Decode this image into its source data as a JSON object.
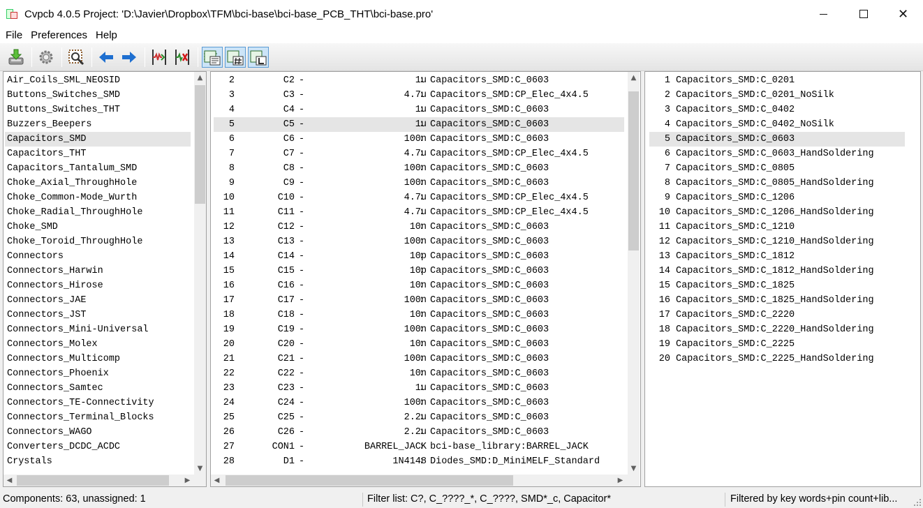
{
  "window": {
    "title": "Cvpcb 4.0.5  Project: 'D:\\Javier\\Dropbox\\TFM\\bci-base\\bci-base_PCB_THT\\bci-base.pro'",
    "minimize": "",
    "maximize": "",
    "close": "✕"
  },
  "menu": [
    "File",
    "Preferences",
    "Help"
  ],
  "toolbar": [
    {
      "icon": "save-netlist-icon"
    },
    {
      "icon": "settings-icon"
    },
    {
      "icon": "view-footprint-icon"
    },
    {
      "icon": "arrow-left-icon"
    },
    {
      "icon": "arrow-right-icon"
    },
    {
      "icon": "auto-associate-icon"
    },
    {
      "icon": "delete-associations-icon"
    },
    {
      "icon": "filter-keywords-icon"
    },
    {
      "icon": "filter-pin-count-icon"
    },
    {
      "icon": "filter-library-icon"
    }
  ],
  "libraries": {
    "selected_index": 4,
    "items": [
      "Air_Coils_SML_NEOSID",
      "Buttons_Switches_SMD",
      "Buttons_Switches_THT",
      "Buzzers_Beepers",
      "Capacitors_SMD",
      "Capacitors_THT",
      "Capacitors_Tantalum_SMD",
      "Choke_Axial_ThroughHole",
      "Choke_Common-Mode_Wurth",
      "Choke_Radial_ThroughHole",
      "Choke_SMD",
      "Choke_Toroid_ThroughHole",
      "Connectors",
      "Connectors_Harwin",
      "Connectors_Hirose",
      "Connectors_JAE",
      "Connectors_JST",
      "Connectors_Mini-Universal",
      "Connectors_Molex",
      "Connectors_Multicomp",
      "Connectors_Phoenix",
      "Connectors_Samtec",
      "Connectors_TE-Connectivity",
      "Connectors_Terminal_Blocks",
      "Connectors_WAGO",
      "Converters_DCDC_ACDC",
      "Crystals"
    ],
    "scroll_position": 0.0
  },
  "components": {
    "selected_index": 3,
    "rows": [
      {
        "num": "2",
        "ref": "C2",
        "value": "1u",
        "footprint": "Capacitors_SMD:C_0603"
      },
      {
        "num": "3",
        "ref": "C3",
        "value": "4.7u",
        "footprint": "Capacitors_SMD:CP_Elec_4x4.5"
      },
      {
        "num": "4",
        "ref": "C4",
        "value": "1u",
        "footprint": "Capacitors_SMD:C_0603"
      },
      {
        "num": "5",
        "ref": "C5",
        "value": "1u",
        "footprint": "Capacitors_SMD:C_0603"
      },
      {
        "num": "6",
        "ref": "C6",
        "value": "100n",
        "footprint": "Capacitors_SMD:C_0603"
      },
      {
        "num": "7",
        "ref": "C7",
        "value": "4.7u",
        "footprint": "Capacitors_SMD:CP_Elec_4x4.5"
      },
      {
        "num": "8",
        "ref": "C8",
        "value": "100n",
        "footprint": "Capacitors_SMD:C_0603"
      },
      {
        "num": "9",
        "ref": "C9",
        "value": "100n",
        "footprint": "Capacitors_SMD:C_0603"
      },
      {
        "num": "10",
        "ref": "C10",
        "value": "4.7u",
        "footprint": "Capacitors_SMD:CP_Elec_4x4.5"
      },
      {
        "num": "11",
        "ref": "C11",
        "value": "4.7u",
        "footprint": "Capacitors_SMD:CP_Elec_4x4.5"
      },
      {
        "num": "12",
        "ref": "C12",
        "value": "10n",
        "footprint": "Capacitors_SMD:C_0603"
      },
      {
        "num": "13",
        "ref": "C13",
        "value": "100n",
        "footprint": "Capacitors_SMD:C_0603"
      },
      {
        "num": "14",
        "ref": "C14",
        "value": "10p",
        "footprint": "Capacitors_SMD:C_0603"
      },
      {
        "num": "15",
        "ref": "C15",
        "value": "10p",
        "footprint": "Capacitors_SMD:C_0603"
      },
      {
        "num": "16",
        "ref": "C16",
        "value": "10n",
        "footprint": "Capacitors_SMD:C_0603"
      },
      {
        "num": "17",
        "ref": "C17",
        "value": "100n",
        "footprint": "Capacitors_SMD:C_0603"
      },
      {
        "num": "18",
        "ref": "C18",
        "value": "10n",
        "footprint": "Capacitors_SMD:C_0603"
      },
      {
        "num": "19",
        "ref": "C19",
        "value": "100n",
        "footprint": "Capacitors_SMD:C_0603"
      },
      {
        "num": "20",
        "ref": "C20",
        "value": "10n",
        "footprint": "Capacitors_SMD:C_0603"
      },
      {
        "num": "21",
        "ref": "C21",
        "value": "100n",
        "footprint": "Capacitors_SMD:C_0603"
      },
      {
        "num": "22",
        "ref": "C22",
        "value": "10n",
        "footprint": "Capacitors_SMD:C_0603"
      },
      {
        "num": "23",
        "ref": "C23",
        "value": "1u",
        "footprint": "Capacitors_SMD:C_0603"
      },
      {
        "num": "24",
        "ref": "C24",
        "value": "100n",
        "footprint": "Capacitors_SMD:C_0603"
      },
      {
        "num": "25",
        "ref": "C25",
        "value": "2.2u",
        "footprint": "Capacitors_SMD:C_0603"
      },
      {
        "num": "26",
        "ref": "C26",
        "value": "2.2u",
        "footprint": "Capacitors_SMD:C_0603"
      },
      {
        "num": "27",
        "ref": "CON1",
        "value": "BARREL_JACK",
        "footprint": "bci-base_library:BARREL_JACK"
      },
      {
        "num": "28",
        "ref": "D1",
        "value": "1N4148",
        "footprint": "Diodes_SMD:D_MiniMELF_Standard"
      }
    ],
    "scroll_position": 0.0
  },
  "footprints": {
    "selected_index": 4,
    "rows": [
      {
        "num": "1",
        "name": "Capacitors_SMD:C_0201"
      },
      {
        "num": "2",
        "name": "Capacitors_SMD:C_0201_NoSilk"
      },
      {
        "num": "3",
        "name": "Capacitors_SMD:C_0402"
      },
      {
        "num": "4",
        "name": "Capacitors_SMD:C_0402_NoSilk"
      },
      {
        "num": "5",
        "name": "Capacitors_SMD:C_0603"
      },
      {
        "num": "6",
        "name": "Capacitors_SMD:C_0603_HandSoldering"
      },
      {
        "num": "7",
        "name": "Capacitors_SMD:C_0805"
      },
      {
        "num": "8",
        "name": "Capacitors_SMD:C_0805_HandSoldering"
      },
      {
        "num": "9",
        "name": "Capacitors_SMD:C_1206"
      },
      {
        "num": "10",
        "name": "Capacitors_SMD:C_1206_HandSoldering"
      },
      {
        "num": "11",
        "name": "Capacitors_SMD:C_1210"
      },
      {
        "num": "12",
        "name": "Capacitors_SMD:C_1210_HandSoldering"
      },
      {
        "num": "13",
        "name": "Capacitors_SMD:C_1812"
      },
      {
        "num": "14",
        "name": "Capacitors_SMD:C_1812_HandSoldering"
      },
      {
        "num": "15",
        "name": "Capacitors_SMD:C_1825"
      },
      {
        "num": "16",
        "name": "Capacitors_SMD:C_1825_HandSoldering"
      },
      {
        "num": "17",
        "name": "Capacitors_SMD:C_2220"
      },
      {
        "num": "18",
        "name": "Capacitors_SMD:C_2220_HandSoldering"
      },
      {
        "num": "19",
        "name": "Capacitors_SMD:C_2225"
      },
      {
        "num": "20",
        "name": "Capacitors_SMD:C_2225_HandSoldering"
      }
    ]
  },
  "status": {
    "components": "Components: 63, unassigned: 1",
    "filter": "Filter list: C?, C_????_*, C_????, SMD*_c, Capacitor*",
    "filtered_by": "Filtered by key words+pin count+lib..."
  },
  "colors": {
    "selection": "#e5e5e5",
    "toggle_bg": "#cce4f7",
    "toggle_border": "#5b9bd5",
    "arrow_blue": "#1e6fd0"
  }
}
